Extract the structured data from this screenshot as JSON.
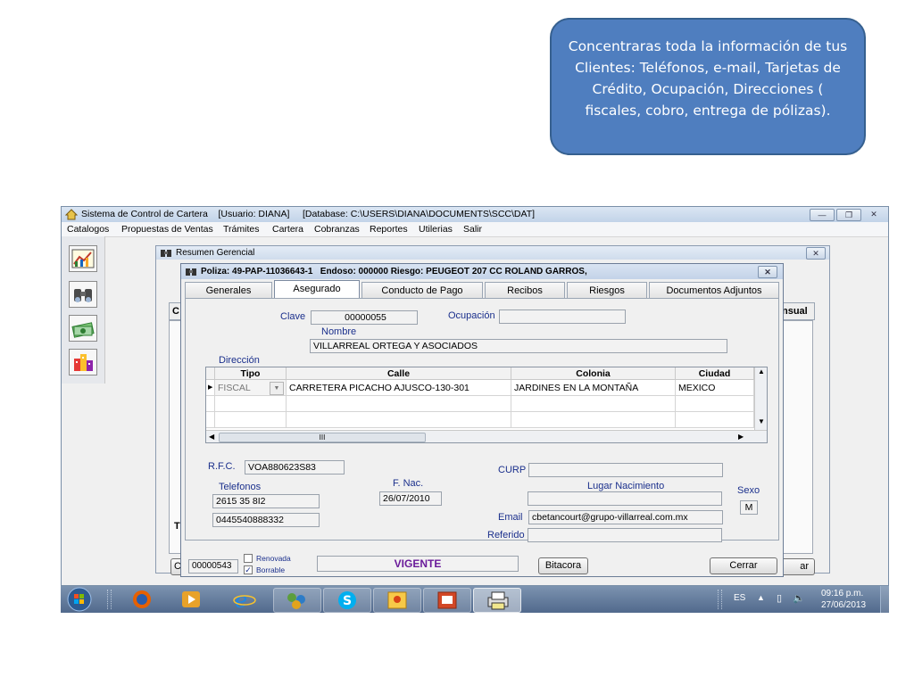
{
  "callout": {
    "text": "Concentraras toda la información de tus Clientes: Teléfonos, e-mail, Tarjetas de Crédito, Ocupación, Direcciones  ( fiscales, cobro, entrega de pólizas)."
  },
  "app": {
    "title": "Sistema de Control de Cartera    [Usuario: DIANA]     [Database: C:\\USERS\\DIANA\\DOCUMENTS\\SCC\\DAT]",
    "menu": [
      "Catalogos",
      "Propuestas de Ventas",
      "Trámites",
      "Cartera",
      "Cobranzas",
      "Reportes",
      "Utilerias",
      "Salir"
    ],
    "resumen_title": "Resumen Gerencial",
    "resumen_partial": {
      "left_c": "C",
      "right_header": "nsual",
      "left_t": "T",
      "bottom_c": "C",
      "bottom_right_button": "ar"
    }
  },
  "poliza": {
    "title": "Poliza: 49-PAP-11036643-1   Endoso: 000000 Riesgo: PEUGEOT 207 CC ROLAND GARROS,",
    "tabs": [
      "Generales",
      "Asegurado",
      "Conducto de Pago",
      "Recibos",
      "Riesgos",
      "Documentos Adjuntos"
    ],
    "active_tab": "Asegurado",
    "clave_label": "Clave",
    "clave_value": "00000055",
    "ocupacion_label": "Ocupación",
    "ocupacion_value": "",
    "nombre_label": "Nombre",
    "nombre_value": "VILLARREAL ORTEGA Y ASOCIADOS",
    "direccion_label": "Dirección",
    "grid": {
      "columns": [
        "Tipo",
        "Calle",
        "Colonia",
        "Ciudad"
      ],
      "rows": [
        {
          "tipo": "FISCAL",
          "calle": "CARRETERA PICACHO AJUSCO-130-301",
          "colonia": "JARDINES EN LA MONTAÑA",
          "ciudad": "MEXICO"
        }
      ],
      "scroll_mid": "III"
    },
    "rfc_label": "R.F.C.",
    "rfc_value": "VOA880623S83",
    "telefonos_label": "Telefonos",
    "telefono_1": "2615 35 8I2",
    "telefono_2": "0445540888332",
    "fnac_label": "F. Nac.",
    "fnac_value": "26/07/2010",
    "curp_label": "CURP",
    "curp_value": "",
    "lugar_label": "Lugar Nacimiento",
    "lugar_value": "",
    "sexo_label": "Sexo",
    "sexo_value": "M",
    "email_label": "Email",
    "email_value": "cbetancourt@grupo-villarreal.com.mx",
    "referido_label": "Referido",
    "referido_value": "",
    "footer": {
      "code": "00000543",
      "renovada_label": "Renovada",
      "renovada_checked": false,
      "borrable_label": "Borrable",
      "borrable_checked": true,
      "status": "VIGENTE",
      "bitacora": "Bitacora",
      "cerrar": "Cerrar"
    }
  },
  "taskbar": {
    "lang": "ES",
    "time": "09:16 p.m.",
    "date": "27/06/2013"
  },
  "colors": {
    "callout_bg": "#4f7ebf",
    "status_text": "#6a1b9a",
    "label_blue": "#1a2f8c"
  }
}
